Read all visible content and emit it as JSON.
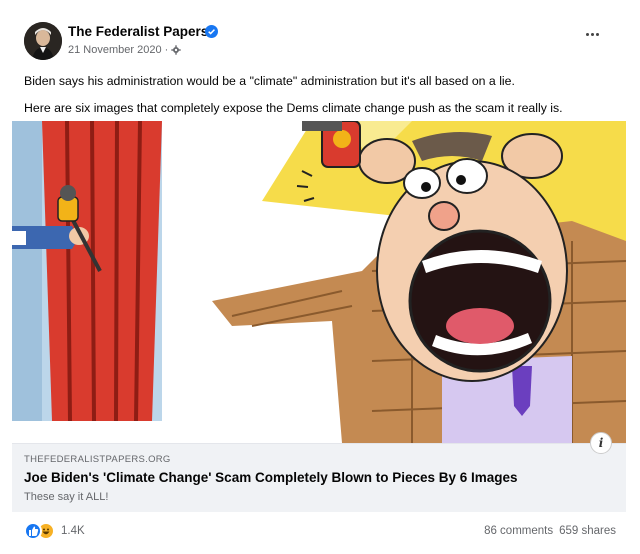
{
  "post": {
    "page_name": "The Federalist Papers",
    "date": "21 November 2020",
    "separator": "·",
    "text_line1": "Biden says his administration would be a \"climate\" administration but it's all based on a lie.",
    "text_line2": "Here are six images that completely expose the Dems climate change push as the scam it really is."
  },
  "link": {
    "domain": "THEFEDERALISTPAPERS.ORG",
    "title": "Joe Biden's 'Climate Change' Scam Completely Blown to Pieces By 6 Images",
    "subtitle": "These say it ALL!",
    "info": "i"
  },
  "footer": {
    "reaction_count": "1.4K",
    "comments": "86 comments",
    "shares": "659 shares"
  },
  "icons": {
    "verified": "verified-badge-icon",
    "privacy": "globe-gear-icon",
    "more": "more-options-icon",
    "like": "like-reaction-icon",
    "haha": "haha-reaction-icon",
    "info": "info-icon"
  },
  "colors": {
    "brand_blue": "#1877f2",
    "secondary_text": "#65676b",
    "card_bg": "#f0f2f5"
  }
}
